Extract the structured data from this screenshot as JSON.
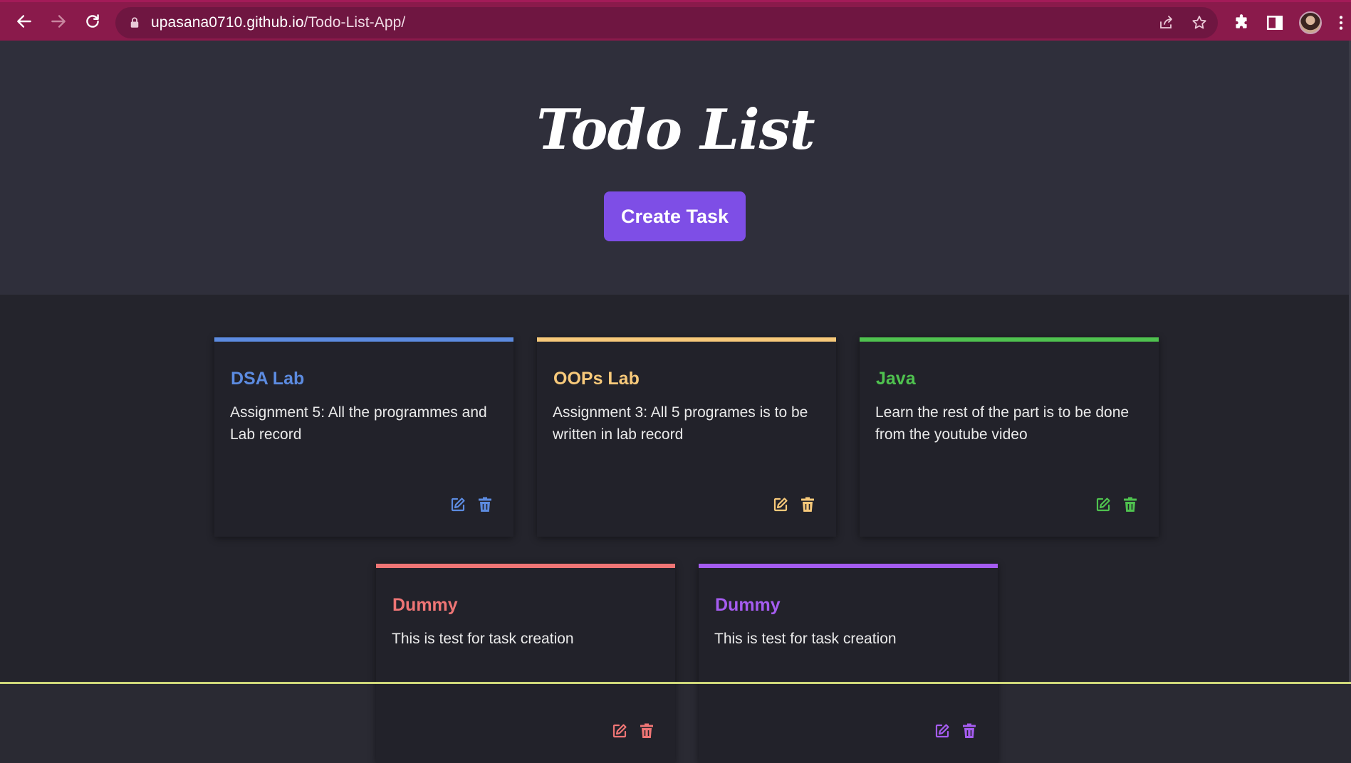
{
  "browser": {
    "url_host": "upasana0710.github.io",
    "url_path": "/Todo-List-App/"
  },
  "header": {
    "title": "Todo List",
    "create_button_label": "Create Task"
  },
  "tasks": [
    {
      "title": "DSA Lab",
      "description": "Assignment 5: All the programmes and Lab record",
      "color": "#5c8be0"
    },
    {
      "title": "OOPs Lab",
      "description": "Assignment 3: All 5 programes is to be written in lab record",
      "color": "#f7c97a"
    },
    {
      "title": "Java",
      "description": "Learn the rest of the part is to be done from the youtube video",
      "color": "#4fc24f"
    },
    {
      "title": "Dummy",
      "description": "This is test for task creation",
      "color": "#ef7575"
    },
    {
      "title": "Dummy",
      "description": "This is test for task creation",
      "color": "#a55cf0"
    }
  ],
  "icons": {
    "edit": "edit-icon",
    "delete": "trash-icon"
  }
}
